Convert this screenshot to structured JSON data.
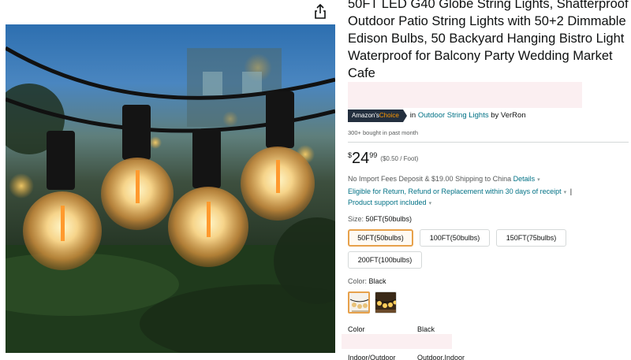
{
  "product": {
    "title": "50FT LED G40 Globe String Lights, Shatterproof Outdoor Patio String Lights with 50+2 Dimmable Edison Bulbs, 50 Backyard Hanging Bistro Light Waterproof for Balcony Party Wedding Market Cafe"
  },
  "badge": {
    "prefix": "Amazon's ",
    "accent": "Choice",
    "accent_color": "#ff9900",
    "text_in": "in ",
    "category": "Outdoor String Lights",
    "text_by": " by VerRon"
  },
  "social_proof": {
    "bought": "300+ bought in past month"
  },
  "price": {
    "symbol": "$",
    "whole": "24",
    "fraction": "99",
    "unit": "($0.50 / Foot)"
  },
  "shipping": {
    "text": "No Import Fees Deposit & $19.00 Shipping to China ",
    "details_link": "Details",
    "returns": "Eligible for Return, Refund or Replacement within 30 days of receipt",
    "separator": "|",
    "support": "Product support included"
  },
  "size": {
    "label": "Size: ",
    "selected": "50FT(50bulbs)",
    "options": [
      "50FT(50bulbs)",
      "100FT(50bulbs)",
      "150FT(75bulbs)",
      "200FT(100bulbs)"
    ]
  },
  "color": {
    "label": "Color: ",
    "selected": "Black",
    "swatch_icons": [
      "string-lights-thumbnail-icon",
      "warm-lights-thumbnail-icon"
    ]
  },
  "specs": [
    {
      "key": "Color",
      "value": "Black"
    },
    {
      "key": "Indoor/Outdoor",
      "value": "Outdoor,Indoor"
    }
  ],
  "colors": {
    "link": "#007185",
    "selected_border": "#e7a14b",
    "badge_bg": "#232f3e"
  },
  "icons": {
    "share": "share-icon",
    "caret": "chevron-down-icon"
  }
}
